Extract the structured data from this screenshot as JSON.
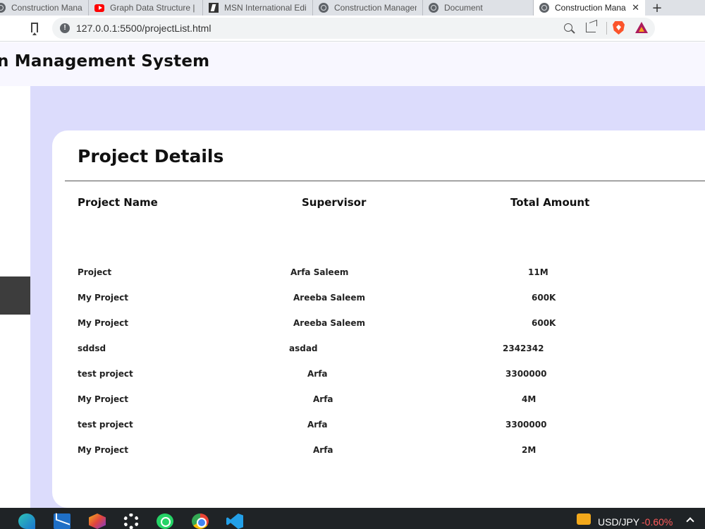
{
  "browser": {
    "tabs": [
      {
        "title": "Construction Managem",
        "icon": "globe-icon"
      },
      {
        "title": "Graph Data Structure |",
        "icon": "youtube-icon"
      },
      {
        "title": "MSN International Edit",
        "icon": "msn-icon"
      },
      {
        "title": "Construction Managem",
        "icon": "globe-icon"
      },
      {
        "title": "Document",
        "icon": "globe-icon"
      },
      {
        "title": "Construction Mana",
        "icon": "globe-icon",
        "active": true
      }
    ],
    "close_glyph": "✕",
    "new_tab_glyph": "+",
    "url": "127.0.0.1:5500/projectList.html",
    "info_glyph": "!"
  },
  "app": {
    "title": "n Management System"
  },
  "project_details": {
    "heading": "Project Details",
    "columns": [
      "Project Name",
      "Supervisor",
      "Total Amount"
    ],
    "rows": [
      {
        "name": "Project",
        "supervisor": "Arfa Saleem",
        "amount": "11M"
      },
      {
        "name": "My Project",
        "supervisor": "Areeba Saleem",
        "amount": "600K"
      },
      {
        "name": "My Project",
        "supervisor": "Areeba Saleem",
        "amount": "600K"
      },
      {
        "name": "sddsd",
        "supervisor": "asdad",
        "amount": "2342342"
      },
      {
        "name": "test project",
        "supervisor": "Arfa",
        "amount": "3300000"
      },
      {
        "name": "My Project",
        "supervisor": "Arfa",
        "amount": "4M"
      },
      {
        "name": "test project",
        "supervisor": "Arfa",
        "amount": "3300000"
      },
      {
        "name": "My Project",
        "supervisor": "Arfa",
        "amount": "2M"
      }
    ]
  },
  "taskbar": {
    "apps": [
      "edge-icon",
      "mail-icon",
      "cube-icon",
      "settings-icon",
      "whatsapp-icon",
      "chrome-icon",
      "vscode-icon"
    ],
    "ticker_label": "USD/JPY",
    "ticker_change": "-0.60%"
  },
  "colors": {
    "content_background": "#dcdcfc",
    "header_background": "#f8f7ff",
    "sidebar_active": "#3d3d3d",
    "ticker_negative": "#ff5a5a"
  }
}
